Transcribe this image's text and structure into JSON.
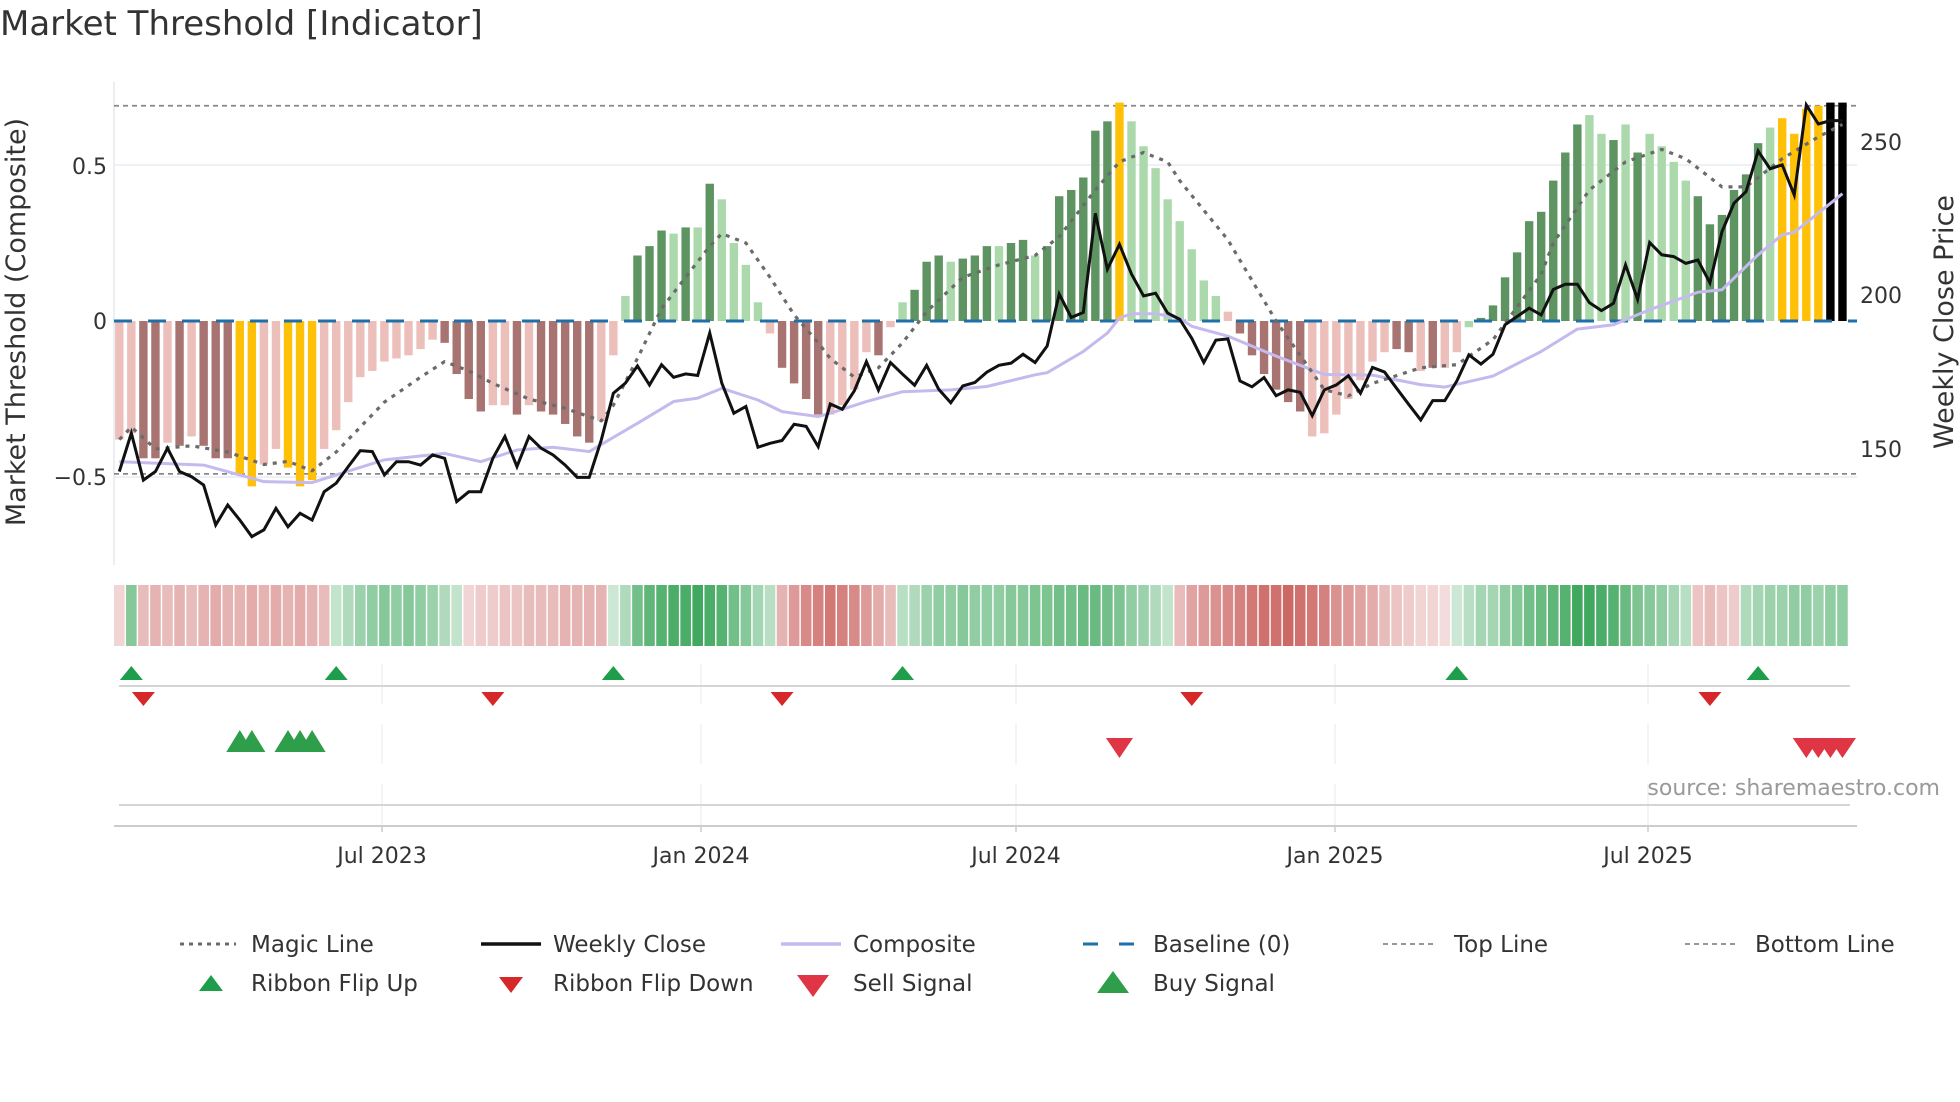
{
  "title": "Market Threshold [Indicator]",
  "source": "source: sharemaestro.com",
  "colors": {
    "bar_dark_green": "#5e9462",
    "bar_light_green": "#acd9ac",
    "bar_dark_red": "#a87472",
    "bar_light_red": "#ecbfbb",
    "bar_extreme": "#ffc107",
    "ribbon_green": "#2ea04f",
    "ribbon_red": "#c4504c",
    "weekly_close": "#111111",
    "composite": "#c5b9ee",
    "magic": "#6b6b6b",
    "baseline": "#1f6fa8",
    "threshold": "#888888",
    "flip_up": "#1e9e4a",
    "flip_down": "#d62828",
    "buy": "#2e9e4a",
    "sell": "#e03545"
  },
  "chart_data": {
    "type": "bar",
    "title": "Market Threshold [Indicator]",
    "ylabel": "Market Threshold (Composite)",
    "y2label": "Weekly Close Price",
    "x_unit": "week index (1 = first weekly bar)",
    "x_ticks": [
      {
        "label": "Jul 2023",
        "week": 22.8
      },
      {
        "label": "Jan 2024",
        "week": 49.3
      },
      {
        "label": "Jul 2024",
        "week": 75.4
      },
      {
        "label": "Jan 2025",
        "week": 101.9
      },
      {
        "label": "Jul 2025",
        "week": 127.9
      }
    ],
    "y_ticks": [
      {
        "label": "0.5",
        "value": 0.5
      },
      {
        "label": "0",
        "value": 0
      },
      {
        "label": "−0.5",
        "value": -0.5
      }
    ],
    "y2_ticks": [
      {
        "label": "250",
        "value": 250
      },
      {
        "label": "200",
        "value": 200
      },
      {
        "label": "150",
        "value": 150
      }
    ],
    "top_line": 0.69,
    "bottom_line": -0.49,
    "composite_bars": [
      -0.38,
      -0.36,
      -0.44,
      -0.44,
      -0.39,
      -0.4,
      -0.37,
      -0.4,
      -0.44,
      -0.44,
      -0.49,
      -0.53,
      -0.46,
      -0.41,
      -0.47,
      -0.53,
      -0.51,
      -0.41,
      -0.35,
      -0.26,
      -0.18,
      -0.16,
      -0.13,
      -0.12,
      -0.11,
      -0.09,
      -0.06,
      -0.07,
      -0.17,
      -0.25,
      -0.29,
      -0.27,
      -0.27,
      -0.3,
      -0.27,
      -0.29,
      -0.3,
      -0.33,
      -0.37,
      -0.39,
      -0.32,
      -0.11,
      0.08,
      0.21,
      0.24,
      0.29,
      0.28,
      0.3,
      0.3,
      0.44,
      0.39,
      0.25,
      0.18,
      0.06,
      -0.04,
      -0.15,
      -0.2,
      -0.25,
      -0.3,
      -0.3,
      -0.27,
      -0.22,
      -0.1,
      -0.11,
      -0.02,
      0.06,
      0.1,
      0.19,
      0.21,
      0.19,
      0.2,
      0.21,
      0.24,
      0.24,
      0.25,
      0.26,
      0.21,
      0.24,
      0.4,
      0.42,
      0.46,
      0.61,
      0.64,
      0.7,
      0.64,
      0.56,
      0.49,
      0.39,
      0.32,
      0.23,
      0.13,
      0.08,
      0.03,
      -0.04,
      -0.11,
      -0.17,
      -0.22,
      -0.26,
      -0.29,
      -0.37,
      -0.36,
      -0.3,
      -0.25,
      -0.19,
      -0.13,
      -0.1,
      -0.09,
      -0.1,
      -0.16,
      -0.15,
      -0.15,
      -0.1,
      -0.02,
      0.01,
      0.05,
      0.14,
      0.22,
      0.32,
      0.35,
      0.45,
      0.54,
      0.63,
      0.66,
      0.6,
      0.58,
      0.63,
      0.54,
      0.6,
      0.56,
      0.51,
      0.45,
      0.4,
      0.31,
      0.34,
      0.42,
      0.47,
      0.57,
      0.62,
      0.65,
      0.6,
      0.68,
      0.69,
      0.7,
      0.7
    ],
    "bar_classes": "rrRRrRrRRRYYrrYYYrrrrrrrrrrRRRRrrRrRRRRRrrgGGGgGgGggggrRRRRrrrrRrgGGGgGGGgGGgGGGGGGYggggggggrRRRRRRrrrrrrrRRrRrrgGGGGGGGGGggGgGggggGGGGGGgYYYY",
    "bar_class_legend": {
      "G": "strong positive",
      "g": "weak positive",
      "R": "strong negative",
      "r": "weak negative",
      "Y": "extreme (beyond threshold)"
    },
    "weekly_close": [
      142.5,
      155.0,
      139.7,
      142.5,
      150.1,
      142.5,
      140.8,
      138.1,
      125.1,
      131.6,
      126.7,
      121.3,
      123.5,
      130.5,
      124.5,
      128.9,
      126.7,
      135.9,
      138.7,
      144.1,
      149.3,
      149.0,
      141.4,
      145.7,
      145.7,
      144.6,
      147.9,
      146.8,
      132.7,
      135.9,
      135.9,
      146.8,
      153.9,
      144.1,
      153.9,
      150.1,
      147.9,
      144.6,
      140.6,
      140.6,
      152.8,
      168.0,
      171.3,
      176.9,
      170.7,
      177.3,
      173.2,
      174.3,
      173.8,
      187.6,
      171.3,
      161.5,
      163.7,
      150.4,
      151.7,
      152.6,
      157.9,
      157.2,
      150.6,
      164.5,
      162.8,
      168.8,
      178.3,
      169.0,
      178.0,
      174.2,
      170.6,
      177.1,
      169.3,
      164.9,
      170.4,
      171.5,
      174.9,
      177.1,
      177.8,
      180.7,
      178.0,
      183.4,
      200.3,
      192.7,
      194.3,
      226.6,
      208.4,
      216.5,
      206.8,
      199.7,
      200.6,
      194.1,
      192.1,
      185.9,
      178.0,
      185.3,
      185.7,
      172.0,
      170.1,
      173.1,
      167.2,
      169.1,
      168.3,
      160.7,
      169.1,
      170.7,
      173.7,
      168.0,
      176.4,
      174.9,
      169.6,
      164.4,
      159.3,
      165.6,
      165.6,
      172.0,
      180.5,
      177.5,
      180.7,
      190.3,
      193.0,
      195.7,
      193.5,
      201.8,
      203.5,
      203.5,
      197.5,
      194.9,
      197.3,
      209.8,
      198.6,
      217.1,
      213.1,
      212.5,
      210.3,
      211.4,
      204.0,
      220.6,
      229.9,
      233.7,
      246.9,
      241.1,
      242.4,
      232.6,
      261.9,
      255.7,
      256.8,
      256.8
    ],
    "composite_line_price": [
      [
        1,
        145.7
      ],
      [
        8,
        144.6
      ],
      [
        13,
        139.2
      ],
      [
        17,
        138.9
      ],
      [
        19,
        141.4
      ],
      [
        23,
        146.3
      ],
      [
        28,
        148.4
      ],
      [
        31,
        145.7
      ],
      [
        34,
        149.5
      ],
      [
        37,
        150.4
      ],
      [
        40,
        149.0
      ],
      [
        44,
        158.2
      ],
      [
        47,
        165.3
      ],
      [
        49,
        166.4
      ],
      [
        51,
        169.6
      ],
      [
        54,
        165.8
      ],
      [
        56,
        162.0
      ],
      [
        59,
        160.4
      ],
      [
        60,
        161.5
      ],
      [
        63,
        165.3
      ],
      [
        66,
        168.5
      ],
      [
        70,
        169.1
      ],
      [
        73,
        170.2
      ],
      [
        77,
        174.0
      ],
      [
        78,
        174.7
      ],
      [
        81,
        181.6
      ],
      [
        83,
        187.6
      ],
      [
        84,
        192.5
      ],
      [
        85,
        193.9
      ],
      [
        87,
        193.9
      ],
      [
        89,
        192.5
      ],
      [
        90,
        189.8
      ],
      [
        93,
        186.6
      ],
      [
        97,
        180.1
      ],
      [
        101,
        174.1
      ],
      [
        105,
        173.9
      ],
      [
        109,
        170.8
      ],
      [
        111,
        170.0
      ],
      [
        115,
        173.6
      ],
      [
        119,
        181.6
      ],
      [
        122,
        188.9
      ],
      [
        125,
        190.3
      ],
      [
        128,
        195.2
      ],
      [
        132,
        200.9
      ],
      [
        134,
        201.7
      ],
      [
        137,
        213.1
      ],
      [
        139,
        219.6
      ],
      [
        140,
        220.4
      ],
      [
        144,
        233.0
      ]
    ],
    "magic_line": [
      [
        1,
        -0.38
      ],
      [
        2,
        -0.34
      ],
      [
        4,
        -0.41
      ],
      [
        7,
        -0.4
      ],
      [
        10,
        -0.42
      ],
      [
        13,
        -0.46
      ],
      [
        15,
        -0.45
      ],
      [
        17,
        -0.48
      ],
      [
        19,
        -0.42
      ],
      [
        21,
        -0.34
      ],
      [
        23,
        -0.26
      ],
      [
        26,
        -0.18
      ],
      [
        28,
        -0.13
      ],
      [
        30,
        -0.16
      ],
      [
        32,
        -0.2
      ],
      [
        35,
        -0.25
      ],
      [
        38,
        -0.28
      ],
      [
        41,
        -0.32
      ],
      [
        42,
        -0.27
      ],
      [
        44,
        -0.12
      ],
      [
        46,
        0.04
      ],
      [
        48,
        0.14
      ],
      [
        50,
        0.24
      ],
      [
        51,
        0.28
      ],
      [
        53,
        0.25
      ],
      [
        55,
        0.14
      ],
      [
        57,
        0.02
      ],
      [
        59,
        -0.07
      ],
      [
        60,
        -0.12
      ],
      [
        62,
        -0.18
      ],
      [
        64,
        -0.15
      ],
      [
        66,
        -0.07
      ],
      [
        68,
        0.03
      ],
      [
        71,
        0.14
      ],
      [
        74,
        0.18
      ],
      [
        77,
        0.21
      ],
      [
        79,
        0.27
      ],
      [
        82,
        0.42
      ],
      [
        84,
        0.51
      ],
      [
        86,
        0.54
      ],
      [
        88,
        0.51
      ],
      [
        89,
        0.45
      ],
      [
        93,
        0.26
      ],
      [
        97,
        0.0
      ],
      [
        101,
        -0.22
      ],
      [
        103,
        -0.24
      ],
      [
        105,
        -0.2
      ],
      [
        109,
        -0.15
      ],
      [
        112,
        -0.14
      ],
      [
        115,
        -0.06
      ],
      [
        119,
        0.15
      ],
      [
        120,
        0.25
      ],
      [
        123,
        0.42
      ],
      [
        126,
        0.51
      ],
      [
        129,
        0.55
      ],
      [
        131,
        0.52
      ],
      [
        134,
        0.43
      ],
      [
        136,
        0.43
      ],
      [
        139,
        0.52
      ],
      [
        142,
        0.59
      ],
      [
        144,
        0.63
      ]
    ],
    "ribbon": [
      -0.15,
      0.5,
      -0.3,
      -0.35,
      -0.3,
      -0.35,
      -0.3,
      -0.35,
      -0.4,
      -0.35,
      -0.35,
      -0.4,
      -0.35,
      -0.4,
      -0.35,
      -0.4,
      -0.35,
      -0.3,
      0.2,
      0.3,
      0.4,
      0.45,
      0.5,
      0.45,
      0.5,
      0.45,
      0.4,
      0.3,
      0.2,
      -0.15,
      -0.2,
      -0.2,
      -0.25,
      -0.25,
      -0.3,
      -0.3,
      -0.3,
      -0.35,
      -0.35,
      -0.35,
      -0.35,
      0.15,
      0.3,
      0.6,
      0.7,
      0.75,
      0.8,
      0.8,
      0.85,
      0.8,
      0.75,
      0.6,
      0.5,
      0.35,
      0.25,
      -0.35,
      -0.5,
      -0.6,
      -0.65,
      -0.7,
      -0.65,
      -0.6,
      -0.5,
      -0.4,
      -0.3,
      0.25,
      0.3,
      0.4,
      0.45,
      0.45,
      0.5,
      0.45,
      0.45,
      0.45,
      0.5,
      0.5,
      0.55,
      0.55,
      0.6,
      0.6,
      0.65,
      0.65,
      0.6,
      0.55,
      0.45,
      0.4,
      0.3,
      0.2,
      -0.3,
      -0.45,
      -0.5,
      -0.55,
      -0.6,
      -0.65,
      -0.7,
      -0.75,
      -0.75,
      -0.8,
      -0.75,
      -0.7,
      -0.65,
      -0.55,
      -0.5,
      -0.45,
      -0.4,
      -0.3,
      -0.25,
      -0.2,
      -0.15,
      -0.15,
      -0.1,
      0.15,
      0.25,
      0.35,
      0.35,
      0.45,
      0.5,
      0.6,
      0.65,
      0.7,
      0.75,
      0.85,
      0.85,
      0.8,
      0.75,
      0.65,
      0.55,
      0.5,
      0.45,
      0.35,
      0.25,
      -0.25,
      -0.3,
      -0.25,
      -0.2,
      0.3,
      0.35,
      0.4,
      0.4,
      0.45,
      0.45,
      0.4,
      0.45,
      0.45
    ],
    "ribbon_flip_up": [
      2,
      19,
      42,
      66,
      112,
      137
    ],
    "ribbon_flip_down": [
      3,
      32,
      56,
      90,
      133
    ],
    "buy_signals": [
      11,
      12,
      15,
      16,
      17
    ],
    "sell_signals": [
      84,
      141,
      142,
      143,
      144
    ],
    "legend": {
      "magic": "Magic Line",
      "close": "Weekly Close",
      "composite": "Composite",
      "baseline": "Baseline (0)",
      "top": "Top Line",
      "bottom": "Bottom Line",
      "flip_up": "Ribbon Flip Up",
      "flip_down": "Ribbon Flip Down",
      "sell": "Sell Signal",
      "buy": "Buy Signal"
    },
    "legend_position": "bottom"
  }
}
